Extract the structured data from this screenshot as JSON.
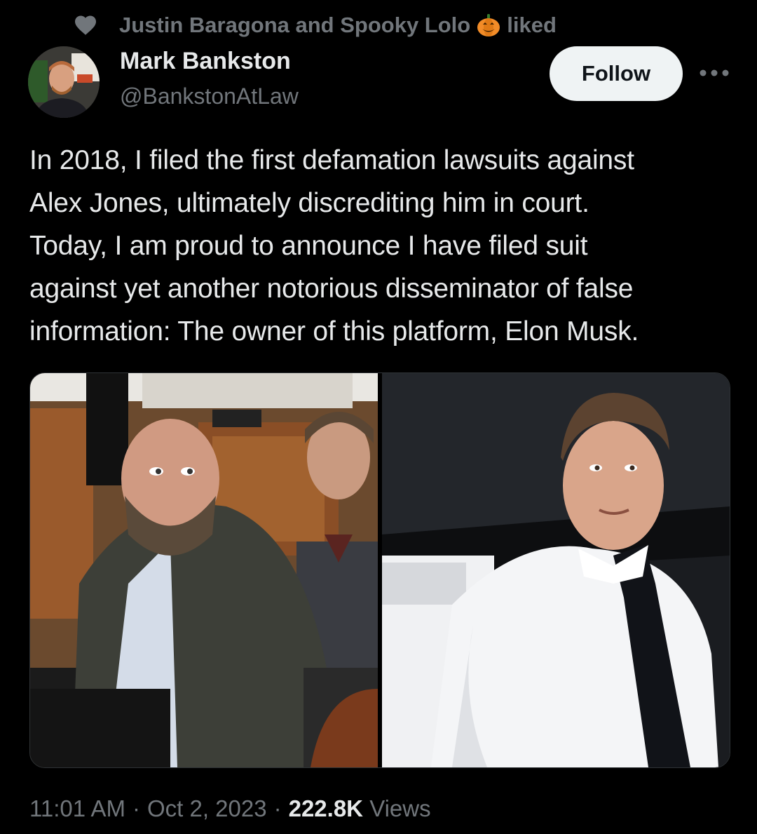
{
  "social_context": {
    "icon": "heart-icon",
    "text_before_emoji": "Justin Baragona and Spooky Lolo",
    "emoji": "pumpkin-icon",
    "text_after_emoji": "liked"
  },
  "author": {
    "display_name": "Mark Bankston",
    "handle": "@BankstonAtLaw",
    "avatar_icon": "avatar"
  },
  "actions": {
    "follow_label": "Follow",
    "more_icon": "more-icon"
  },
  "tweet": {
    "text": "In 2018, I filed the first defamation lawsuits against\nAlex Jones, ultimately discrediting him in court.\nToday, I am proud to announce I have filed suit\nagainst yet another notorious disseminator of false\ninformation: The owner of this platform, Elon Musk."
  },
  "media": {
    "photo_count": 2
  },
  "meta": {
    "time": "11:01 AM",
    "separator": "·",
    "date": "Oct 2, 2023",
    "views_count": "222.8K",
    "views_label": "Views"
  },
  "colors": {
    "background": "#000000",
    "primary_text": "#e7e9ea",
    "secondary_text": "#71767b",
    "follow_bg": "#eff3f4",
    "follow_text": "#0f1419",
    "pumpkin": "#f28c28"
  }
}
